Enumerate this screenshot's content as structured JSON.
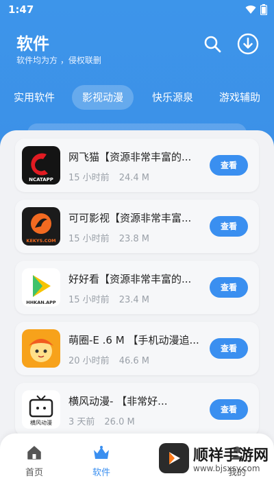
{
  "status": {
    "time": "1:47"
  },
  "header": {
    "title": "软件",
    "subtitle": "软件均为方        ，侵权联删",
    "search_icon": "search-icon",
    "download_icon": "download-icon"
  },
  "tabs": [
    {
      "label": "实用软件",
      "active": false
    },
    {
      "label": "影视动漫",
      "active": true
    },
    {
      "label": "快乐源泉",
      "active": false
    },
    {
      "label": "游戏辅助",
      "active": false
    }
  ],
  "apps": [
    {
      "name": "网飞猫【资源非常丰富的...",
      "time": "15 小时前",
      "size": "24.4 M",
      "button": "查看",
      "icon_text": "NCATAPP",
      "icon_bg": "#141414",
      "icon_accent": "#e11b22"
    },
    {
      "name": "可可影视【资源非常丰富...",
      "time": "15 小时前",
      "size": "23.8 M",
      "button": "查看",
      "icon_text": "KEKYS.COM",
      "icon_bg": "#1b1b1b",
      "icon_accent": "#f26a21"
    },
    {
      "name": "好好看【资源非常丰富的...",
      "time": "15 小时前",
      "size": "23.4 M",
      "button": "查看",
      "icon_text": "HHKAN.APP",
      "icon_bg": "#ffffff",
      "icon_accent": "#f7c400"
    },
    {
      "name": "萌圈-E   .6 M  【手机动漫追...",
      "time": "20 小时前",
      "size": "46.6 M",
      "button": "查看",
      "icon_text": "",
      "icon_bg": "#f7a21b",
      "icon_accent": "#ffe08a"
    },
    {
      "name": "横风动漫-          【非常好...",
      "time": "3 天前",
      "size": "26.0 M",
      "button": "查看",
      "icon_text": "横风动漫",
      "icon_bg": "#ffffff",
      "icon_accent": "#222222"
    }
  ],
  "nav": [
    {
      "label": "首页",
      "active": false
    },
    {
      "label": "软件",
      "active": true
    },
    {
      "label": "我的",
      "active": false
    }
  ],
  "watermark": {
    "title": "顺祥手游网",
    "url": "www.bjsxsy.com"
  },
  "colors": {
    "primary": "#3a8ff0",
    "header_bg": "#3d95ea",
    "meta_gray": "#9aa0a8"
  }
}
